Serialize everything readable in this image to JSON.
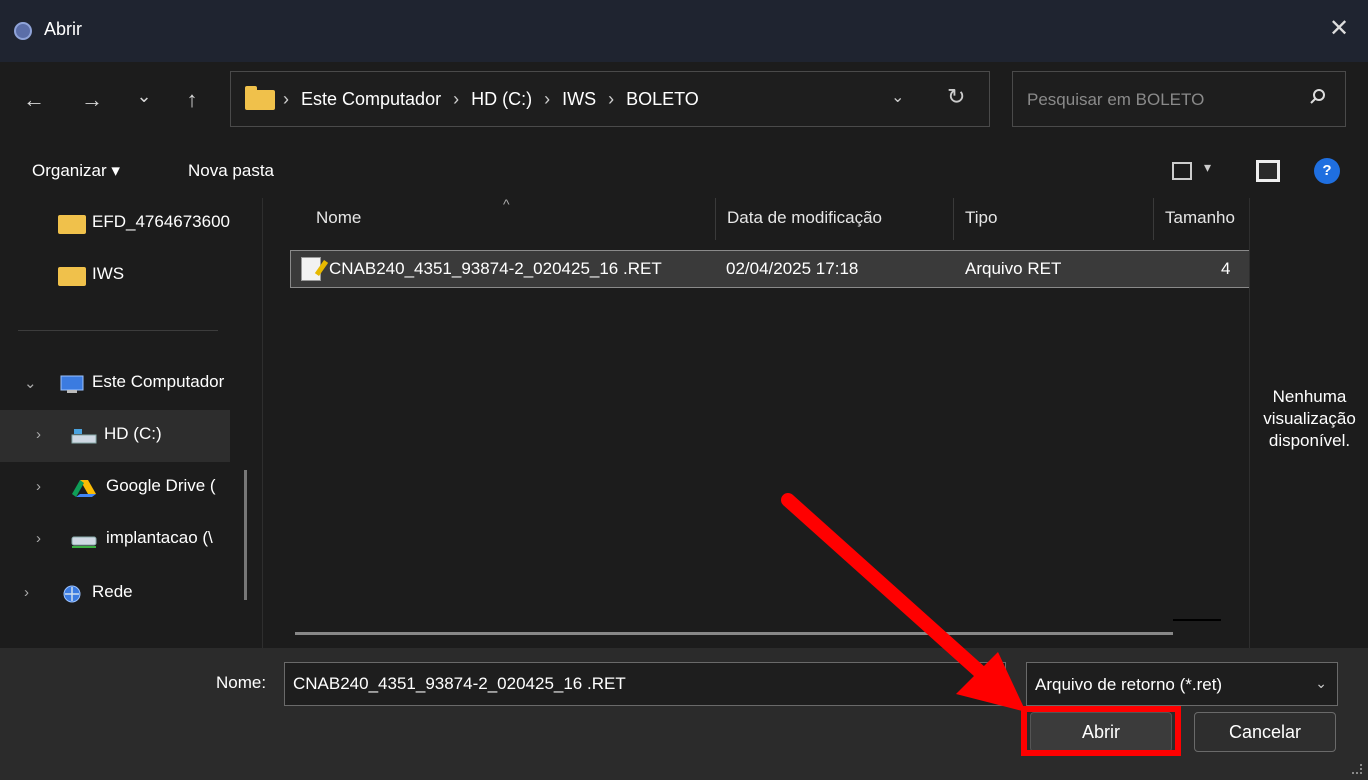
{
  "window": {
    "title": "Abrir",
    "close_glyph": "✕"
  },
  "nav": {
    "back_glyph": "←",
    "forward_glyph": "→",
    "recent_glyph": "⌄",
    "up_glyph": "↑",
    "breadcrumbs": [
      "Este Computador",
      "HD (C:)",
      "IWS",
      "BOLETO"
    ],
    "breadcrumb_sep": "›",
    "dropdown_glyph": "⌄",
    "refresh_glyph": "↻",
    "search_placeholder": "Pesquisar em BOLETO"
  },
  "toolbar": {
    "organize_label": "Organizar ▾",
    "new_folder_label": "Nova pasta",
    "view_caret": "▾",
    "help_glyph": "?"
  },
  "sidebar": {
    "items": [
      {
        "label": "EFD_4764673600",
        "icon": "folder-icon"
      },
      {
        "label": "IWS",
        "icon": "folder-icon"
      },
      {
        "label": "Este Computador",
        "icon": "computer-icon",
        "caret": "⌄"
      },
      {
        "label": "HD (C:)",
        "icon": "drive-icon",
        "caret": "›"
      },
      {
        "label": "Google Drive (",
        "icon": "google-drive-icon",
        "caret": "›"
      },
      {
        "label": "implantacao (\\",
        "icon": "network-drive-icon",
        "caret": "›"
      },
      {
        "label": "Rede",
        "icon": "network-icon",
        "caret": "›"
      }
    ]
  },
  "files": {
    "columns": [
      "Nome",
      "Data de modificação",
      "Tipo",
      "Tamanho"
    ],
    "sort_glyph": "^",
    "rows": [
      {
        "name": "CNAB240_4351_93874-2_020425_16 .RET",
        "modified": "02/04/2025 17:18",
        "type": "Arquivo RET",
        "size": "4"
      }
    ]
  },
  "preview": {
    "message": "Nenhuma visualização disponível."
  },
  "footer": {
    "name_label": "Nome:",
    "filename": "CNAB240_4351_93874-2_020425_16 .RET",
    "file_type": "Arquivo de retorno (*.ret)",
    "file_type_caret": "⌄",
    "open_label": "Abrir",
    "cancel_label": "Cancelar"
  },
  "colors": {
    "annotation": "#ff0000",
    "accent": "#1f6fe0",
    "folder": "#f0c14b"
  }
}
